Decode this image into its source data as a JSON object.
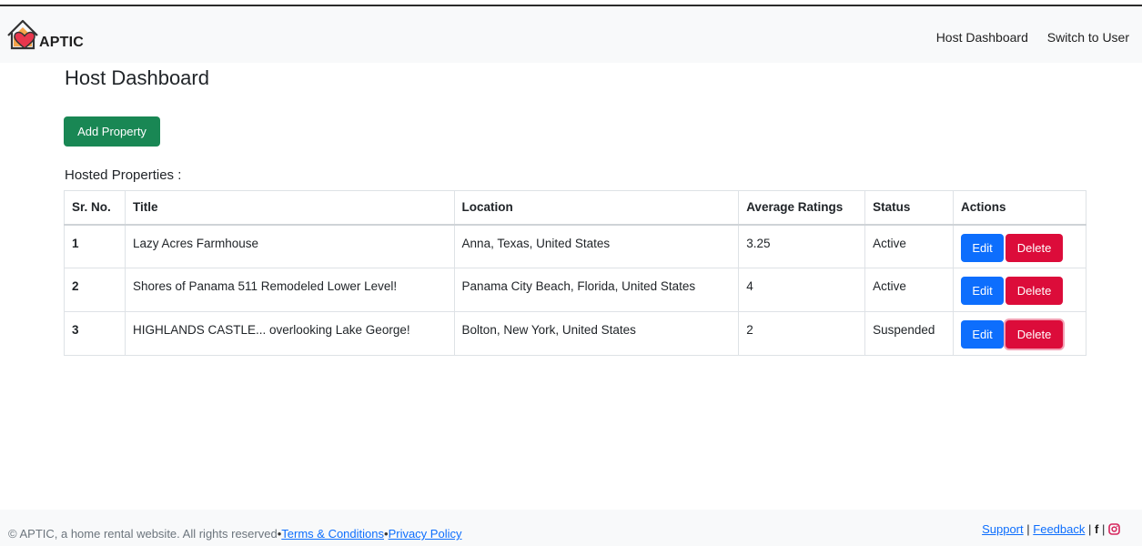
{
  "brand": {
    "name": "APTIC"
  },
  "nav": {
    "items": [
      "Host Dashboard",
      "Switch to User"
    ]
  },
  "page": {
    "title": "Host Dashboard",
    "add_button": "Add Property",
    "section_title": "Hosted Properties :"
  },
  "table": {
    "headers": [
      "Sr. No.",
      "Title",
      "Location",
      "Average Ratings",
      "Status",
      "Actions"
    ],
    "rows": [
      {
        "sr": "1",
        "title": "Lazy Acres Farmhouse",
        "location": "Anna, Texas, United States",
        "rating": "3.25",
        "status": "Active",
        "edit": "Edit",
        "delete": "Delete"
      },
      {
        "sr": "2",
        "title": "Shores of Panama 511 Remodeled Lower Level!",
        "location": "Panama City Beach, Florida, United States",
        "rating": "4",
        "status": "Active",
        "edit": "Edit",
        "delete": "Delete"
      },
      {
        "sr": "3",
        "title": "HIGHLANDS CASTLE... overlooking Lake George!",
        "location": "Bolton, New York, United States",
        "rating": "2",
        "status": "Suspended",
        "edit": "Edit",
        "delete": "Delete"
      }
    ]
  },
  "footer": {
    "copyright": "© APTIC, a home rental website. All rights reserved",
    "separator": "•",
    "terms": "Terms & Conditions",
    "privacy": "Privacy Policy",
    "support": "Support",
    "feedback": "Feedback",
    "pipe": "|",
    "facebook_icon": "f"
  },
  "colors": {
    "success": "#198754",
    "primary": "#0d6efd",
    "danger": "#dc0c3a",
    "logo_orange": "#f5a44a",
    "logo_heart": "#e8374d"
  }
}
